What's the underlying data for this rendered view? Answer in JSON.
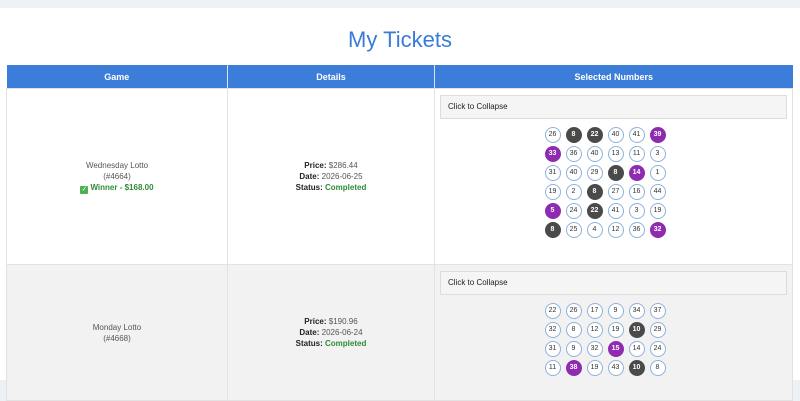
{
  "page": {
    "title": "My Tickets"
  },
  "table": {
    "headers": [
      "Game",
      "Details",
      "Selected Numbers"
    ],
    "rows": [
      {
        "game_name": "Wednesday Lotto",
        "ticket_id": "(#4664)",
        "winner_text": "Winner - $168.00",
        "price_label": "Price:",
        "price": "$286.44",
        "date_label": "Date:",
        "date": "2026-06-25",
        "status_label": "Status:",
        "status": "Completed",
        "collapse_label": "Click to Collapse",
        "numbers": [
          {
            "n": "26",
            "s": "plain"
          },
          {
            "n": "8",
            "s": "dark"
          },
          {
            "n": "22",
            "s": "dark"
          },
          {
            "n": "40",
            "s": "plain"
          },
          {
            "n": "41",
            "s": "plain"
          },
          {
            "n": "39",
            "s": "purple"
          },
          {
            "n": "33",
            "s": "purple"
          },
          {
            "n": "36",
            "s": "plain"
          },
          {
            "n": "40",
            "s": "plain"
          },
          {
            "n": "13",
            "s": "plain"
          },
          {
            "n": "11",
            "s": "plain"
          },
          {
            "n": "3",
            "s": "plain"
          },
          {
            "n": "31",
            "s": "plain"
          },
          {
            "n": "40",
            "s": "plain"
          },
          {
            "n": "29",
            "s": "plain"
          },
          {
            "n": "8",
            "s": "dark"
          },
          {
            "n": "14",
            "s": "purple"
          },
          {
            "n": "1",
            "s": "plain"
          },
          {
            "n": "19",
            "s": "plain"
          },
          {
            "n": "2",
            "s": "plain"
          },
          {
            "n": "8",
            "s": "dark"
          },
          {
            "n": "27",
            "s": "plain"
          },
          {
            "n": "16",
            "s": "plain"
          },
          {
            "n": "44",
            "s": "plain"
          },
          {
            "n": "5",
            "s": "purple"
          },
          {
            "n": "24",
            "s": "plain"
          },
          {
            "n": "22",
            "s": "dark"
          },
          {
            "n": "41",
            "s": "plain"
          },
          {
            "n": "3",
            "s": "plain"
          },
          {
            "n": "19",
            "s": "plain"
          },
          {
            "n": "8",
            "s": "dark"
          },
          {
            "n": "25",
            "s": "plain"
          },
          {
            "n": "4",
            "s": "plain"
          },
          {
            "n": "12",
            "s": "plain"
          },
          {
            "n": "36",
            "s": "plain"
          },
          {
            "n": "32",
            "s": "purple"
          }
        ]
      },
      {
        "game_name": "Monday Lotto",
        "ticket_id": "(#4668)",
        "price_label": "Price:",
        "price": "$190.96",
        "date_label": "Date:",
        "date": "2026-06-24",
        "status_label": "Status:",
        "status": "Completed",
        "collapse_label": "Click to Collapse",
        "numbers": [
          {
            "n": "22",
            "s": "plain"
          },
          {
            "n": "26",
            "s": "plain"
          },
          {
            "n": "17",
            "s": "plain"
          },
          {
            "n": "9",
            "s": "plain"
          },
          {
            "n": "34",
            "s": "plain"
          },
          {
            "n": "37",
            "s": "plain"
          },
          {
            "n": "32",
            "s": "plain"
          },
          {
            "n": "8",
            "s": "plain"
          },
          {
            "n": "12",
            "s": "plain"
          },
          {
            "n": "19",
            "s": "plain"
          },
          {
            "n": "10",
            "s": "dark"
          },
          {
            "n": "29",
            "s": "plain"
          },
          {
            "n": "31",
            "s": "plain"
          },
          {
            "n": "9",
            "s": "plain"
          },
          {
            "n": "32",
            "s": "plain"
          },
          {
            "n": "15",
            "s": "purple"
          },
          {
            "n": "14",
            "s": "plain"
          },
          {
            "n": "24",
            "s": "plain"
          },
          {
            "n": "11",
            "s": "plain"
          },
          {
            "n": "38",
            "s": "purple"
          },
          {
            "n": "19",
            "s": "plain"
          },
          {
            "n": "43",
            "s": "plain"
          },
          {
            "n": "10",
            "s": "dark"
          },
          {
            "n": "8",
            "s": "plain"
          }
        ]
      }
    ]
  },
  "colors": {
    "accent": "#3b7dd8",
    "title": "#3a7bd5",
    "dark_ball": "#4a4a4a",
    "purple_ball": "#8e2bb0",
    "success": "#2e8b3a"
  }
}
